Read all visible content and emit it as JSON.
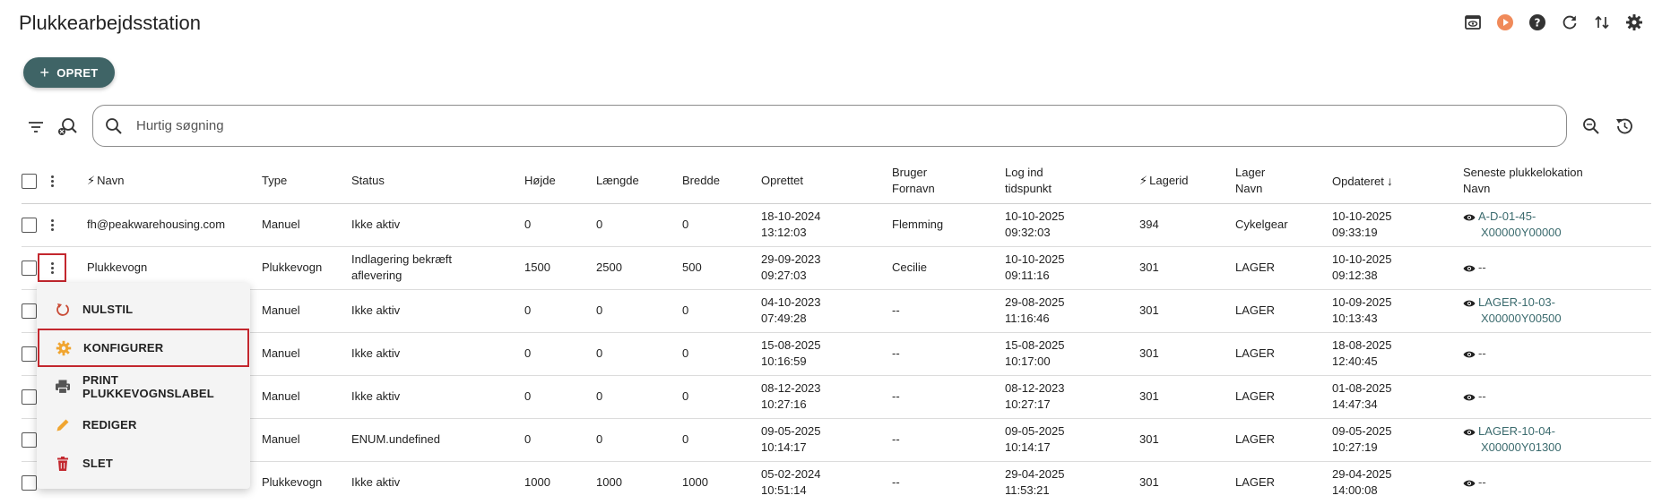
{
  "page": {
    "title": "Plukkearbejdsstation"
  },
  "toolbar": {
    "create_label": "OPRET"
  },
  "search": {
    "placeholder": "Hurtig søgning"
  },
  "colors": {
    "accent": "#3f6466",
    "highlight": "#c3272e",
    "link": "#3b6b6e",
    "orange": "#f08a5a",
    "menu_icon_reset": "#c94b36",
    "menu_icon_config": "#f0a530",
    "menu_icon_edit": "#f0a530",
    "menu_icon_delete": "#c3272e"
  },
  "top_icons": [
    "preview-icon",
    "play-icon",
    "help-icon",
    "refresh-icon",
    "sort-icon",
    "settings-icon"
  ],
  "table": {
    "headers": {
      "navn": "Navn",
      "type": "Type",
      "status": "Status",
      "hojde": "Højde",
      "laengde": "Længde",
      "bredde": "Bredde",
      "oprettet": "Oprettet",
      "bruger1": "Bruger",
      "bruger2": "Fornavn",
      "login1": "Log ind",
      "login2": "tidspunkt",
      "lagerid": "Lagerid",
      "lager1": "Lager",
      "lager2": "Navn",
      "opdateret": "Opdateret",
      "seneste1": "Seneste plukkelokation",
      "seneste2": "Navn"
    },
    "rows": [
      {
        "navn": "fh@peakwarehousing.com",
        "type": "Manuel",
        "status1": "Ikke aktiv",
        "status2": "",
        "hojde": "0",
        "laengde": "0",
        "bredde": "0",
        "opr1": "18-10-2024",
        "opr2": "13:12:03",
        "bruger": "Flemming",
        "log1": "10-10-2025",
        "log2": "09:32:03",
        "lagerid": "394",
        "lager": "Cykelgear",
        "opd1": "10-10-2025",
        "opd2": "09:33:19",
        "loc1": "A-D-01-45-",
        "loc2": "X00000Y00000"
      },
      {
        "navn": "Plukkevogn",
        "type": "Plukkevogn",
        "status1": "Indlagering bekræft",
        "status2": "aflevering",
        "hojde": "1500",
        "laengde": "2500",
        "bredde": "500",
        "opr1": "29-09-2023",
        "opr2": "09:27:03",
        "bruger": "Cecilie",
        "log1": "10-10-2025",
        "log2": "09:11:16",
        "lagerid": "301",
        "lager": "LAGER",
        "opd1": "10-10-2025",
        "opd2": "09:12:38",
        "loc1": "--",
        "loc2": ""
      },
      {
        "navn": "",
        "type": "Manuel",
        "status1": "Ikke aktiv",
        "status2": "",
        "hojde": "0",
        "laengde": "0",
        "bredde": "0",
        "opr1": "04-10-2023",
        "opr2": "07:49:28",
        "bruger": "--",
        "log1": "29-08-2025",
        "log2": "11:16:46",
        "lagerid": "301",
        "lager": "LAGER",
        "opd1": "10-09-2025",
        "opd2": "10:13:43",
        "loc1": "LAGER-10-03-",
        "loc2": "X00000Y00500"
      },
      {
        "navn": "",
        "type": "Manuel",
        "status1": "Ikke aktiv",
        "status2": "",
        "hojde": "0",
        "laengde": "0",
        "bredde": "0",
        "opr1": "15-08-2025",
        "opr2": "10:16:59",
        "bruger": "--",
        "log1": "15-08-2025",
        "log2": "10:17:00",
        "lagerid": "301",
        "lager": "LAGER",
        "opd1": "18-08-2025",
        "opd2": "12:40:45",
        "loc1": "--",
        "loc2": ""
      },
      {
        "navn": "",
        "type": "Manuel",
        "status1": "Ikke aktiv",
        "status2": "",
        "hojde": "0",
        "laengde": "0",
        "bredde": "0",
        "opr1": "08-12-2023",
        "opr2": "10:27:16",
        "bruger": "--",
        "log1": "08-12-2023",
        "log2": "10:27:17",
        "lagerid": "301",
        "lager": "LAGER",
        "opd1": "01-08-2025",
        "opd2": "14:47:34",
        "loc1": "--",
        "loc2": ""
      },
      {
        "navn": "",
        "type": "Manuel",
        "status1": "ENUM.undefined",
        "status2": "",
        "hojde": "0",
        "laengde": "0",
        "bredde": "0",
        "opr1": "09-05-2025",
        "opr2": "10:14:17",
        "bruger": "--",
        "log1": "09-05-2025",
        "log2": "10:14:17",
        "lagerid": "301",
        "lager": "LAGER",
        "opd1": "09-05-2025",
        "opd2": "10:27:19",
        "loc1": "LAGER-10-04-",
        "loc2": "X00000Y01300"
      },
      {
        "navn": "",
        "type": "Plukkevogn",
        "status1": "Ikke aktiv",
        "status2": "",
        "hojde": "1000",
        "laengde": "1000",
        "bredde": "1000",
        "opr1": "05-02-2024",
        "opr2": "10:51:14",
        "bruger": "--",
        "log1": "29-04-2025",
        "log2": "11:53:21",
        "lagerid": "301",
        "lager": "LAGER",
        "opd1": "29-04-2025",
        "opd2": "14:00:08",
        "loc1": "--",
        "loc2": ""
      }
    ]
  },
  "context_menu": {
    "items": [
      {
        "label": "NULSTIL",
        "icon": "reset-icon"
      },
      {
        "label": "KONFIGURER",
        "icon": "gear-icon"
      },
      {
        "label": "PRINT PLUKKEVOGNSLABEL",
        "icon": "printer-icon"
      },
      {
        "label": "REDIGER",
        "icon": "pencil-icon"
      },
      {
        "label": "SLET",
        "icon": "trash-icon"
      }
    ]
  }
}
